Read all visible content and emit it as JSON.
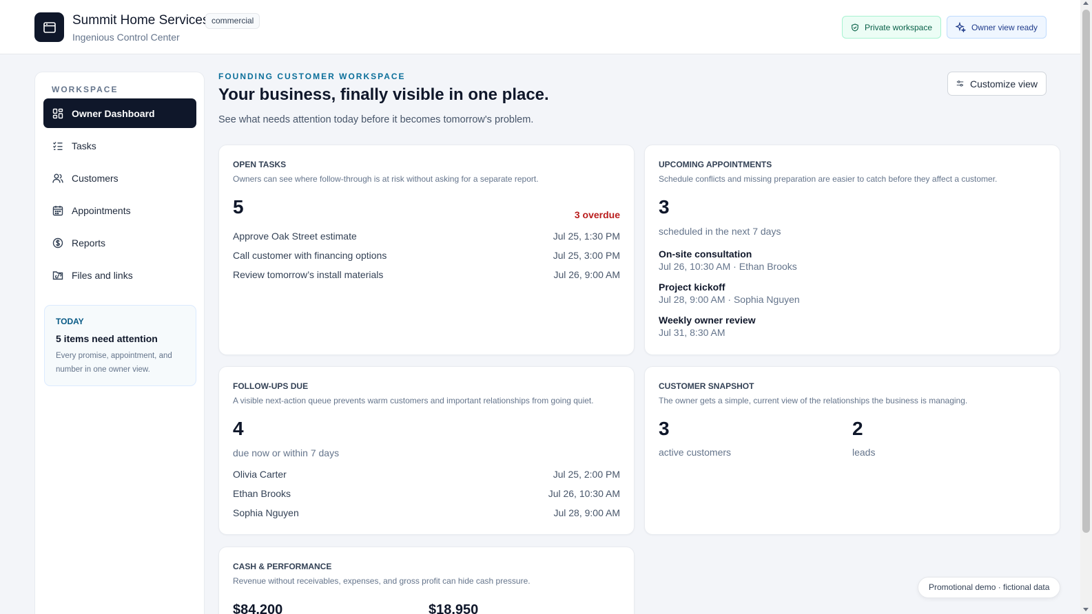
{
  "header": {
    "app_name": "Summit Home Services",
    "tag": "commercial",
    "subtitle": "Ingenious Control Center",
    "private_label": "Private workspace",
    "owner_label": "Owner view ready",
    "logo_icon": "browser-window-icon"
  },
  "sidebar": {
    "section_label": "WORKSPACE",
    "items": [
      {
        "label": "Owner Dashboard",
        "icon": "dashboard-grid-icon",
        "active": true
      },
      {
        "label": "Tasks",
        "icon": "checklist-icon"
      },
      {
        "label": "Customers",
        "icon": "users-icon"
      },
      {
        "label": "Appointments",
        "icon": "calendar-icon"
      },
      {
        "label": "Reports",
        "icon": "dollar-circle-icon"
      },
      {
        "label": "Files and links",
        "icon": "folder-link-icon"
      }
    ],
    "today": {
      "label": "TODAY",
      "title": "5 items need attention",
      "text": "Every promise, appointment, and number in one owner view."
    }
  },
  "main": {
    "eyebrow": "FOUNDING CUSTOMER WORKSPACE",
    "headline": "Your business, finally visible in one place.",
    "subline": "See what needs attention today before it becomes tomorrow's problem.",
    "customize_label": "Customize view"
  },
  "open_tasks": {
    "title": "OPEN TASKS",
    "desc": "Owners can see where follow-through is at risk without asking for a separate report.",
    "count": "5",
    "overdue": "3 overdue",
    "items": [
      {
        "name": "Approve Oak Street estimate",
        "when": "Jul 25, 1:30 PM"
      },
      {
        "name": "Call customer with financing options",
        "when": "Jul 25, 3:00 PM"
      },
      {
        "name": "Review tomorrow’s install materials",
        "when": "Jul 26, 9:00 AM"
      }
    ]
  },
  "appointments": {
    "title": "UPCOMING APPOINTMENTS",
    "desc": "Schedule conflicts and missing preparation are easier to catch before they affect a customer.",
    "count": "3",
    "count_label": "scheduled in the next 7 days",
    "items": [
      {
        "name": "On-site consultation",
        "meta": "Jul 26, 10:30 AM · Ethan Brooks"
      },
      {
        "name": "Project kickoff",
        "meta": "Jul 28, 9:00 AM · Sophia Nguyen"
      },
      {
        "name": "Weekly owner review",
        "meta": "Jul 31, 8:30 AM"
      }
    ]
  },
  "followups": {
    "title": "FOLLOW-UPS DUE",
    "desc": "A visible next-action queue prevents warm customers and important relationships from going quiet.",
    "count": "4",
    "count_label": "due now or within 7 days",
    "items": [
      {
        "name": "Olivia Carter",
        "when": "Jul 25, 2:00 PM"
      },
      {
        "name": "Ethan Brooks",
        "when": "Jul 26, 10:30 AM"
      },
      {
        "name": "Sophia Nguyen",
        "when": "Jul 28, 9:00 AM"
      }
    ]
  },
  "snapshot": {
    "title": "CUSTOMER SNAPSHOT",
    "desc": "The owner gets a simple, current view of the relationships the business is managing.",
    "active_count": "3",
    "active_label": "active customers",
    "leads_count": "2",
    "leads_label": "leads"
  },
  "cash": {
    "title": "CASH & PERFORMANCE",
    "desc": "Revenue without receivables, expenses, and gross profit can hide cash pressure.",
    "value_a": "$84,200",
    "value_b": "$18,950"
  },
  "footer": {
    "demo_label": "Promotional demo · fictional data"
  }
}
